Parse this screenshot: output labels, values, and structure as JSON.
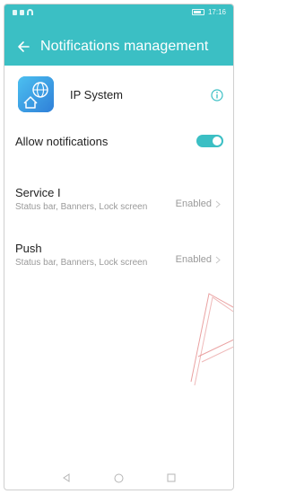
{
  "statusbar": {
    "time": "17:16",
    "icons": [
      "sim-icon",
      "signal-icon",
      "wifi-icon",
      "battery-icon"
    ]
  },
  "appbar": {
    "title": "Notifications management",
    "back_icon": "back-arrow-icon",
    "color": "#3bbfc4"
  },
  "app": {
    "name": "IP System",
    "icon": "ip-system-app-icon",
    "info_icon": "info-icon"
  },
  "allow": {
    "label": "Allow notifications",
    "enabled": true
  },
  "channels": [
    {
      "name": "Service I",
      "description": "Status bar, Banners, Lock screen",
      "status": "Enabled"
    },
    {
      "name": "Push",
      "description": "Status bar, Banners, Lock screen",
      "status": "Enabled"
    }
  ],
  "navbar": {
    "icons": [
      "back-triangle-icon",
      "home-circle-icon",
      "recents-square-icon"
    ]
  },
  "colors": {
    "accent": "#3bbfc4",
    "secondary_text": "#9a9a9a",
    "watermark": "#e58a8a"
  }
}
